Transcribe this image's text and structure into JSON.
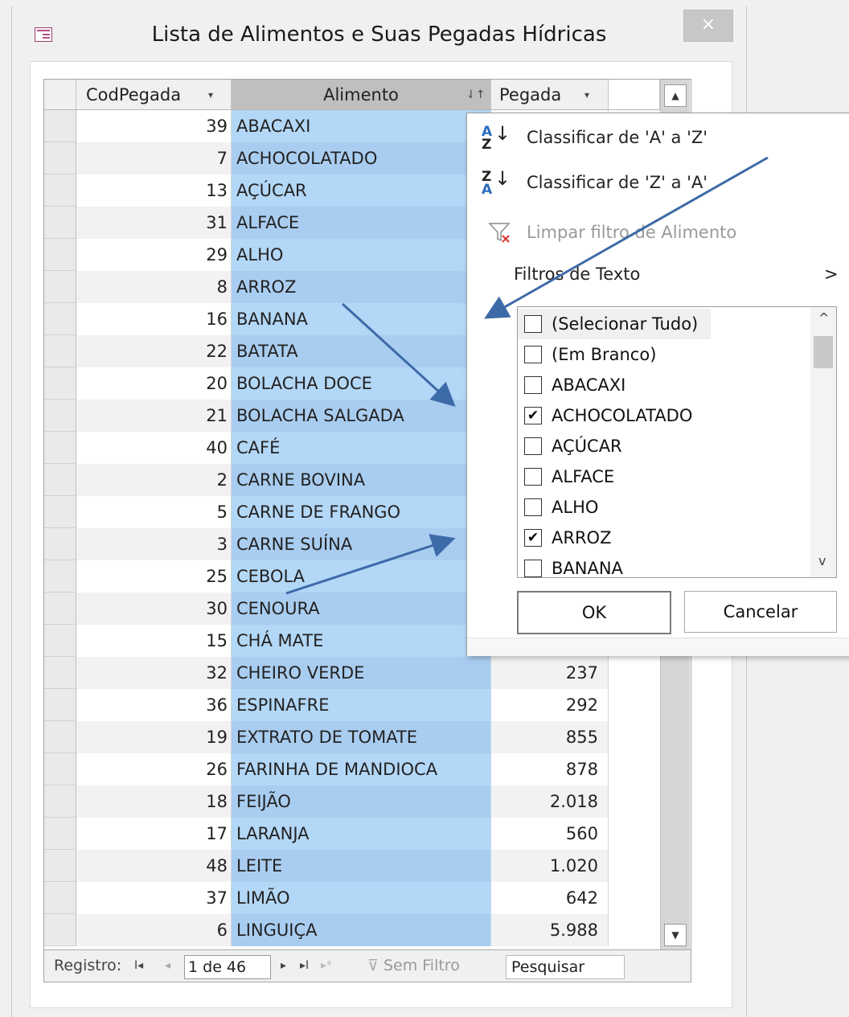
{
  "window": {
    "title": "Lista de Alimentos e Suas Pegadas Hídricas",
    "close_label": "×"
  },
  "columns": {
    "cod": "CodPegada",
    "alimento": "Alimento",
    "pegada": "Pegada",
    "dd": "▾",
    "sort_mark": "⇃↑"
  },
  "rows": [
    {
      "cod": "39",
      "alimento": "ABACAXI",
      "pegada": ""
    },
    {
      "cod": "7",
      "alimento": "ACHOCOLATADO",
      "pegada": ""
    },
    {
      "cod": "13",
      "alimento": "AÇÚCAR",
      "pegada": ""
    },
    {
      "cod": "31",
      "alimento": "ALFACE",
      "pegada": ""
    },
    {
      "cod": "29",
      "alimento": "ALHO",
      "pegada": ""
    },
    {
      "cod": "8",
      "alimento": "ARROZ",
      "pegada": ""
    },
    {
      "cod": "16",
      "alimento": "BANANA",
      "pegada": ""
    },
    {
      "cod": "22",
      "alimento": "BATATA",
      "pegada": ""
    },
    {
      "cod": "20",
      "alimento": "BOLACHA DOCE",
      "pegada": ""
    },
    {
      "cod": "21",
      "alimento": "BOLACHA SALGADA",
      "pegada": ""
    },
    {
      "cod": "40",
      "alimento": "CAFÉ",
      "pegada": ""
    },
    {
      "cod": "2",
      "alimento": "CARNE BOVINA",
      "pegada": ""
    },
    {
      "cod": "5",
      "alimento": "CARNE DE FRANGO",
      "pegada": ""
    },
    {
      "cod": "3",
      "alimento": "CARNE SUÍNA",
      "pegada": ""
    },
    {
      "cod": "25",
      "alimento": "CEBOLA",
      "pegada": ""
    },
    {
      "cod": "30",
      "alimento": "CENOURA",
      "pegada": ""
    },
    {
      "cod": "15",
      "alimento": "CHÁ MATE",
      "pegada": ""
    },
    {
      "cod": "32",
      "alimento": "CHEIRO VERDE",
      "pegada": "237"
    },
    {
      "cod": "36",
      "alimento": "ESPINAFRE",
      "pegada": "292"
    },
    {
      "cod": "19",
      "alimento": "EXTRATO DE TOMATE",
      "pegada": "855"
    },
    {
      "cod": "26",
      "alimento": "FARINHA DE MANDIOCA",
      "pegada": "878"
    },
    {
      "cod": "18",
      "alimento": "FEIJÃO",
      "pegada": "2.018"
    },
    {
      "cod": "17",
      "alimento": "LARANJA",
      "pegada": "560"
    },
    {
      "cod": "48",
      "alimento": "LEITE",
      "pegada": "1.020"
    },
    {
      "cod": "37",
      "alimento": "LIMÃO",
      "pegada": "642"
    },
    {
      "cod": "6",
      "alimento": "LINGUIÇA",
      "pegada": "5.988"
    }
  ],
  "navbar": {
    "registro_label": "Registro:",
    "first": "I◂",
    "prev": "◂",
    "position": "1 de 46",
    "next": "▸",
    "last": "▸I",
    "new": "▸*",
    "filter_status": "Sem Filtro",
    "search": "Pesquisar"
  },
  "popup": {
    "sort_az": "Classificar de 'A' a 'Z'",
    "sort_za": "Classificar de 'Z' a 'A'",
    "clear_filter": "Limpar filtro de Alimento",
    "text_filters": "Filtros de Texto",
    "chevron": ">",
    "items": [
      {
        "label": "(Selecionar Tudo)",
        "checked": false
      },
      {
        "label": "(Em Branco)",
        "checked": false
      },
      {
        "label": "ABACAXI",
        "checked": false
      },
      {
        "label": "ACHOCOLATADO",
        "checked": true
      },
      {
        "label": "AÇÚCAR",
        "checked": false
      },
      {
        "label": "ALFACE",
        "checked": false
      },
      {
        "label": "ALHO",
        "checked": false
      },
      {
        "label": "ARROZ",
        "checked": true
      },
      {
        "label": "BANANA",
        "checked": false
      }
    ],
    "ok": "OK",
    "cancel": "Cancelar"
  },
  "icons": {
    "sort_az_top": "A",
    "sort_az_bottom": "Z",
    "sort_za_top": "Z",
    "sort_za_bottom": "A",
    "sort_arrow": "↓",
    "scroll_up": "▲",
    "scroll_down": "▼",
    "list_up": "^",
    "list_down": "v",
    "check": "✔"
  },
  "colors": {
    "selection_blue": "#b3d7f6",
    "arrow_blue": "#3d6aa8"
  }
}
